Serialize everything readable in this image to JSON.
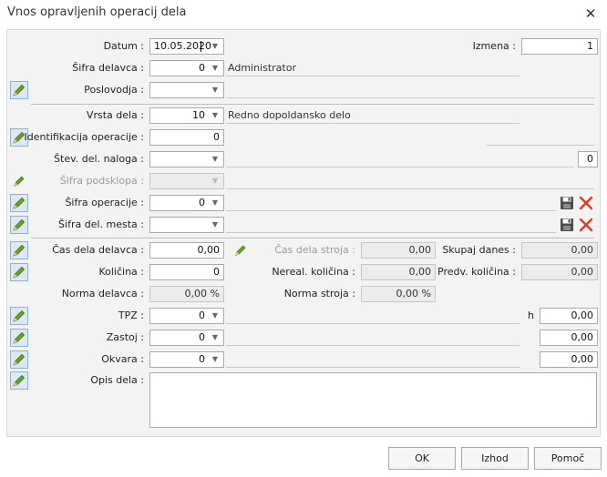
{
  "window": {
    "title": "Vnos opravljenih operacij dela"
  },
  "fields": {
    "datum": {
      "label": "Datum :",
      "value": "10.05.2020"
    },
    "izmena": {
      "label": "Izmena :",
      "value": "1"
    },
    "sifra_delavca": {
      "label": "Šifra delavca :",
      "value": "0",
      "desc": "Administrator"
    },
    "poslovodja": {
      "label": "Poslovodja :",
      "value": ""
    },
    "vrsta_dela": {
      "label": "Vrsta dela :",
      "value": "10",
      "desc": "Redno dopoldansko delo"
    },
    "identifikacija_operacije": {
      "label": "Identifikacija operacije :",
      "value": "0"
    },
    "stev_del_naloga": {
      "label": "Štev. del. naloga :",
      "value": "",
      "extra": "0"
    },
    "sifra_podsklopa": {
      "label": "Šifra podsklopa :",
      "value": ""
    },
    "sifra_operacije": {
      "label": "Šifra operacije :",
      "value": "0"
    },
    "sifra_del_mesta": {
      "label": "Šifra del. mesta :",
      "value": ""
    },
    "cas_dela_delavca": {
      "label": "Čas dela delavca :",
      "value": "0,00"
    },
    "cas_dela_stroja": {
      "label": "Čas dela stroja :",
      "value": "0,00"
    },
    "skupaj_danes": {
      "label": "Skupaj danes :",
      "value": "0,00"
    },
    "kolicina": {
      "label": "Količina :",
      "value": "0"
    },
    "nereal_kolicina": {
      "label": "Nereal. količina :",
      "value": "0,00"
    },
    "predv_kolicina": {
      "label": "Predv. količina :",
      "value": "0,00"
    },
    "norma_delavca": {
      "label": "Norma delavca :",
      "value": "0,00 %"
    },
    "norma_stroja": {
      "label": "Norma stroja :",
      "value": "0,00 %"
    },
    "tpz": {
      "label": "TPZ :",
      "value": "0",
      "unit": "h",
      "amount": "0,00"
    },
    "zastoj": {
      "label": "Zastoj :",
      "value": "0",
      "amount": "0,00"
    },
    "okvara": {
      "label": "Okvara :",
      "value": "0",
      "amount": "0,00"
    },
    "opis_dela": {
      "label": "Opis dela :",
      "value": ""
    }
  },
  "buttons": {
    "ok": "OK",
    "izhod": "Izhod",
    "pomoc": "Pomoč"
  },
  "icons": {
    "pencil": "pencil-icon",
    "save": "floppy-disk-icon",
    "delete": "red-x-icon",
    "dropdown": "chevron-down-icon",
    "close": "close-icon"
  },
  "colors": {
    "pencil": "#6aa329",
    "delete": "#e23a1f",
    "pencil_button_bg": "#dce8f6",
    "panel_bg": "#f3f3f3"
  }
}
